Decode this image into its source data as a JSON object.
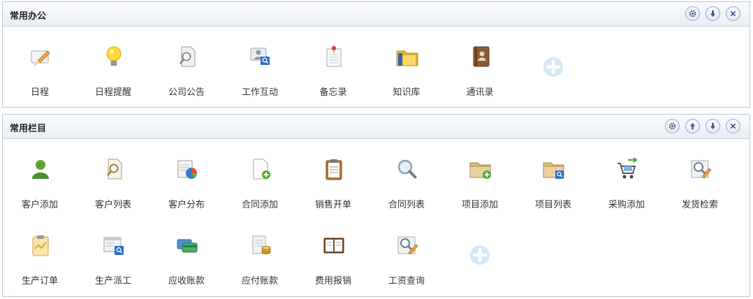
{
  "panels": [
    {
      "title": "常用办公",
      "items": [
        {
          "label": "日程",
          "icon": "pencil-note-icon"
        },
        {
          "label": "日程提醒",
          "icon": "lightbulb-icon"
        },
        {
          "label": "公司公告",
          "icon": "document-search-icon"
        },
        {
          "label": "工作互动",
          "icon": "user-chat-icon"
        },
        {
          "label": "备忘录",
          "icon": "memo-pin-icon"
        },
        {
          "label": "知识库",
          "icon": "folder-book-icon"
        },
        {
          "label": "通讯录",
          "icon": "address-book-icon"
        }
      ]
    },
    {
      "title": "常用栏目",
      "items": [
        {
          "label": "客户添加",
          "icon": "user-add-icon"
        },
        {
          "label": "客户列表",
          "icon": "document-search-icon"
        },
        {
          "label": "客户分布",
          "icon": "pie-chart-icon"
        },
        {
          "label": "合同添加",
          "icon": "document-add-icon"
        },
        {
          "label": "销售开单",
          "icon": "clipboard-icon"
        },
        {
          "label": "合同列表",
          "icon": "magnifier-icon"
        },
        {
          "label": "项目添加",
          "icon": "folder-add-icon"
        },
        {
          "label": "项目列表",
          "icon": "folder-search-icon"
        },
        {
          "label": "采购添加",
          "icon": "cart-add-icon"
        },
        {
          "label": "发货检索",
          "icon": "search-edit-icon"
        },
        {
          "label": "生产订单",
          "icon": "clipboard-chart-icon"
        },
        {
          "label": "生产派工",
          "icon": "window-search-icon"
        },
        {
          "label": "应收账款",
          "icon": "cards-icon"
        },
        {
          "label": "应付账款",
          "icon": "bill-coins-icon"
        },
        {
          "label": "费用报销",
          "icon": "ledger-icon"
        },
        {
          "label": "工资查询",
          "icon": "search-edit-icon"
        }
      ]
    }
  ],
  "colors": {
    "border": "#b9c7d9",
    "add_icon": "#d3e9f8",
    "accent_blue": "#2b6fc9"
  }
}
